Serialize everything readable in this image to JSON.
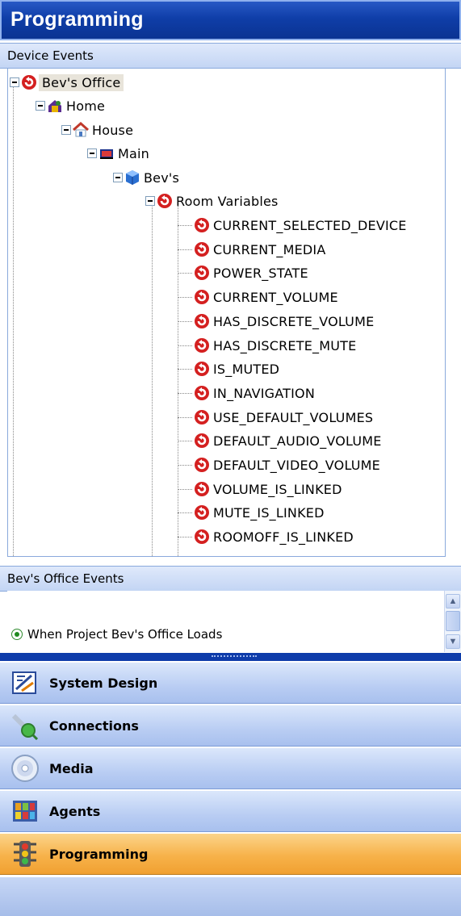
{
  "window": {
    "title": "Programming"
  },
  "device_events": {
    "header": "Device Events",
    "tree": {
      "root": "Bev's Office",
      "home": "Home",
      "house": "House",
      "main": "Main",
      "room": "Bev's",
      "room_variables": "Room Variables",
      "variables": [
        "CURRENT_SELECTED_DEVICE",
        "CURRENT_MEDIA",
        "POWER_STATE",
        "CURRENT_VOLUME",
        "HAS_DISCRETE_VOLUME",
        "HAS_DISCRETE_MUTE",
        "IS_MUTED",
        "IN_NAVIGATION",
        "USE_DEFAULT_VOLUMES",
        "DEFAULT_AUDIO_VOLUME",
        "DEFAULT_VIDEO_VOLUME",
        "VOLUME_IS_LINKED",
        "MUTE_IS_LINKED",
        "ROOMOFF_IS_LINKED"
      ]
    }
  },
  "office_events": {
    "header": "Bev's Office Events",
    "items": [
      "When Project Bev's Office Loads"
    ]
  },
  "nav": [
    {
      "label": "System Design",
      "icon": "system-design-icon",
      "active": false
    },
    {
      "label": "Connections",
      "icon": "connections-icon",
      "active": false
    },
    {
      "label": "Media",
      "icon": "media-icon",
      "active": false
    },
    {
      "label": "Agents",
      "icon": "agents-icon",
      "active": false
    },
    {
      "label": "Programming",
      "icon": "traffic-light-icon",
      "active": true
    }
  ],
  "colors": {
    "title_bar": "#0f3ea8",
    "event_icon": "#d42020",
    "active_nav": "#f7b24a"
  }
}
